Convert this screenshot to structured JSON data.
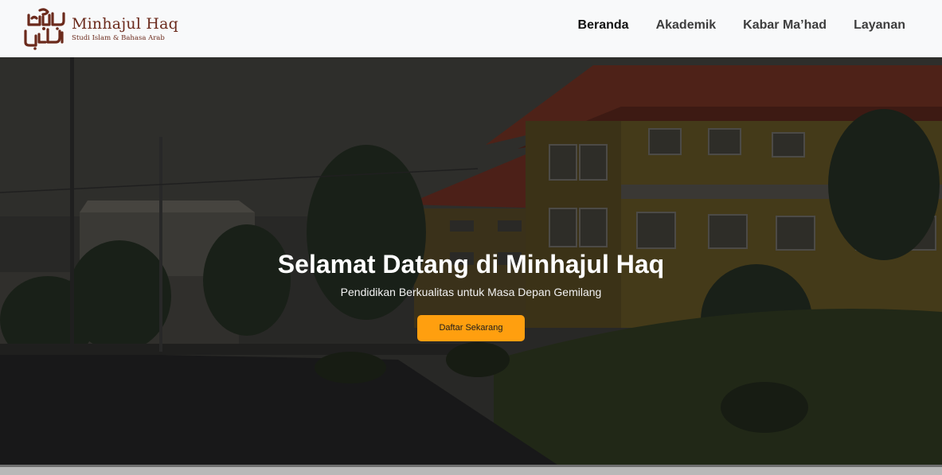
{
  "brand": {
    "logo_icon": "arabic-calligraphy-logo",
    "name": "Minhajul Haq",
    "tagline": "Studi Islam & Bahasa Arab",
    "color": "#6b2a1c"
  },
  "nav": {
    "items": [
      {
        "label": "Beranda",
        "active": true
      },
      {
        "label": "Akademik",
        "active": false
      },
      {
        "label": "Kabar Ma’had",
        "active": false
      },
      {
        "label": "Layanan",
        "active": false
      }
    ]
  },
  "hero": {
    "title": "Selamat Datang di Minhajul Haq",
    "subtitle": "Pendidikan Berkualitas untuk Masa Depan Gemilang",
    "cta_label": "Daftar Sekarang",
    "cta_color": "#ff9f0f",
    "background": "campus-building-photo"
  }
}
